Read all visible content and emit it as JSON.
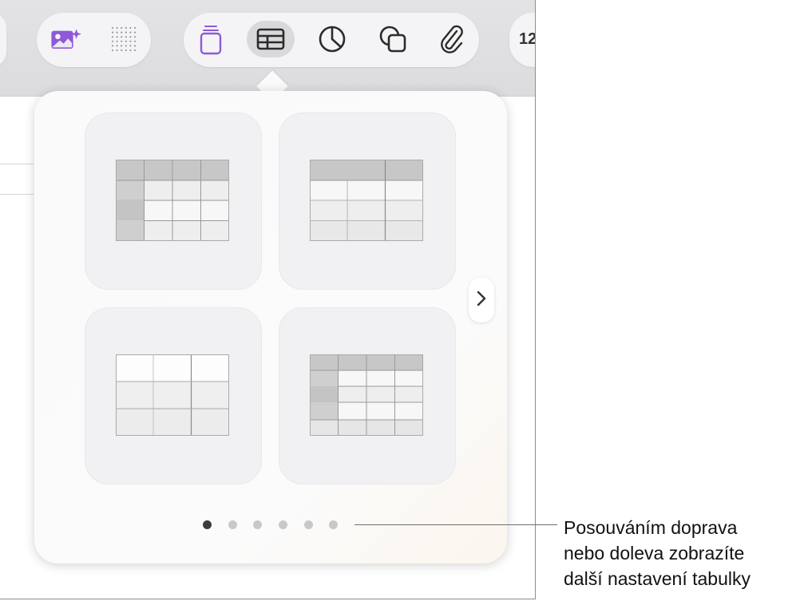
{
  "toolbar": {
    "icons": [
      "image-sparkle-icon",
      "dot-grid-icon",
      "text-box-icon",
      "table-icon",
      "chart-icon",
      "shape-icon",
      "paperclip-icon"
    ],
    "number_label": "12",
    "accent_color": "#8e5ad8"
  },
  "table_styles": [
    "header-row-and-column-table",
    "header-row-table",
    "plain-table",
    "header-row-column-and-footer-table"
  ],
  "pagination": {
    "pages": 6,
    "current": 1
  },
  "callout": {
    "lines": [
      "Posouváním doprava",
      "nebo doleva zobrazíte",
      "další nastavení tabulky"
    ]
  }
}
